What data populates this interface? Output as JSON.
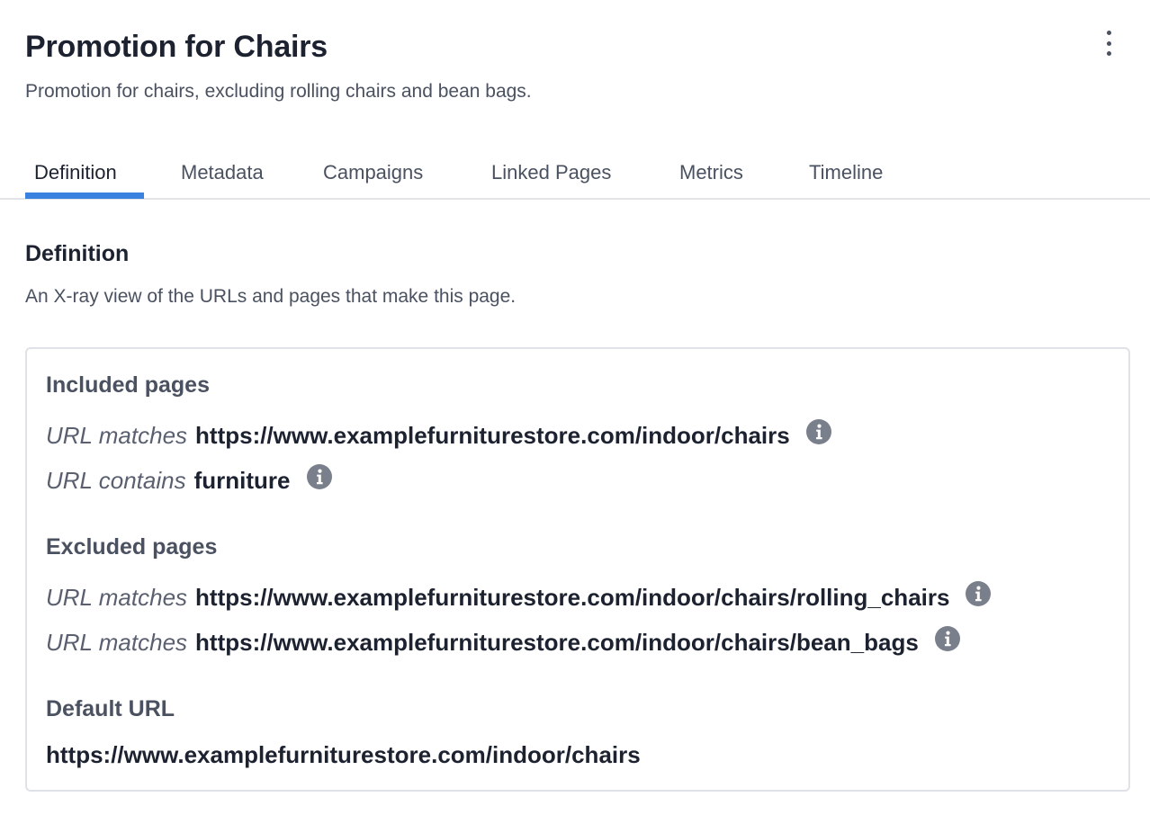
{
  "header": {
    "title": "Promotion for Chairs",
    "subtitle": "Promotion for chairs, excluding rolling chairs and bean bags.",
    "menu_icon": "more-vertical-icon"
  },
  "tabs": [
    {
      "label": "Definition",
      "active": true
    },
    {
      "label": "Metadata",
      "active": false
    },
    {
      "label": "Campaigns",
      "active": false
    },
    {
      "label": "Linked Pages",
      "active": false
    },
    {
      "label": "Metrics",
      "active": false
    },
    {
      "label": "Timeline",
      "active": false
    }
  ],
  "section": {
    "title": "Definition",
    "description": "An X-ray view of the URLs and pages that make this page."
  },
  "included": {
    "title": "Included pages",
    "rules": [
      {
        "operator": "URL matches",
        "value": "https://www.examplefurniturestore.com/indoor/chairs",
        "icon": "info-icon"
      },
      {
        "operator": "URL contains",
        "value": "furniture",
        "icon": "info-icon"
      }
    ]
  },
  "excluded": {
    "title": "Excluded pages",
    "rules": [
      {
        "operator": "URL matches",
        "value": "https://www.examplefurniturestore.com/indoor/chairs/rolling_chairs",
        "icon": "info-icon"
      },
      {
        "operator": "URL matches",
        "value": "https://www.examplefurniturestore.com/indoor/chairs/bean_bags",
        "icon": "info-icon"
      }
    ]
  },
  "default_url": {
    "title": "Default URL",
    "value": "https://www.examplefurniturestore.com/indoor/chairs"
  },
  "colors": {
    "accent": "#3b82e0",
    "icon": "#7a7f8c"
  }
}
